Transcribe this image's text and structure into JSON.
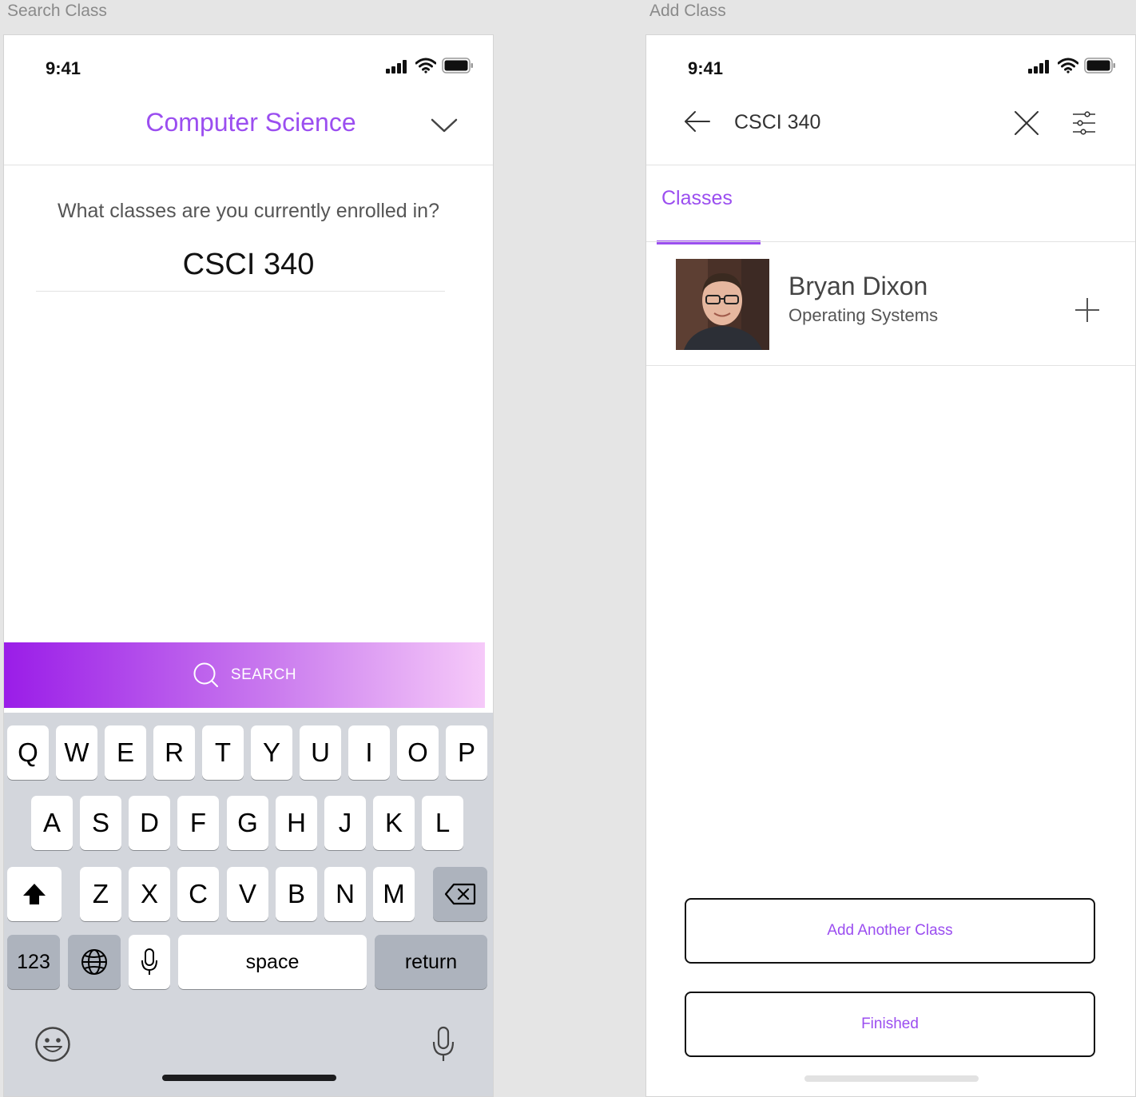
{
  "artboards": [
    {
      "label": "Search Class"
    },
    {
      "label": "Add Class"
    }
  ],
  "search_screen": {
    "status_time": "9:41",
    "department": "Computer Science",
    "question": "What classes are you currently enrolled in?",
    "query": "CSCI 340",
    "search_button": "SEARCH",
    "keyboard": {
      "row1": [
        "Q",
        "W",
        "E",
        "R",
        "T",
        "Y",
        "U",
        "I",
        "O",
        "P"
      ],
      "row2": [
        "A",
        "S",
        "D",
        "F",
        "G",
        "H",
        "J",
        "K",
        "L"
      ],
      "row3": [
        "Z",
        "X",
        "C",
        "V",
        "B",
        "N",
        "M"
      ],
      "numbers_key": "123",
      "space_key": "space",
      "return_key": "return"
    }
  },
  "add_screen": {
    "status_time": "9:41",
    "search_query": "CSCI 340",
    "tab": "Classes",
    "result": {
      "name": "Bryan Dixon",
      "course": "Operating Systems"
    },
    "add_another_button": "Add Another Class",
    "finished_button": "Finished"
  },
  "colors": {
    "accent": "#9b4ef0",
    "gradient_start": "#9a1de8",
    "gradient_end": "#f6caf9",
    "keyboard_bg": "#d3d6dc",
    "canvas_bg": "#e5e5e5"
  },
  "icons": [
    "signal-icon",
    "wifi-icon",
    "battery-icon",
    "chevron-down-icon",
    "search-icon",
    "shift-icon",
    "backspace-icon",
    "globe-icon",
    "microphone-icon",
    "emoji-icon",
    "back-arrow-icon",
    "close-icon",
    "filter-sliders-icon",
    "plus-icon"
  ]
}
